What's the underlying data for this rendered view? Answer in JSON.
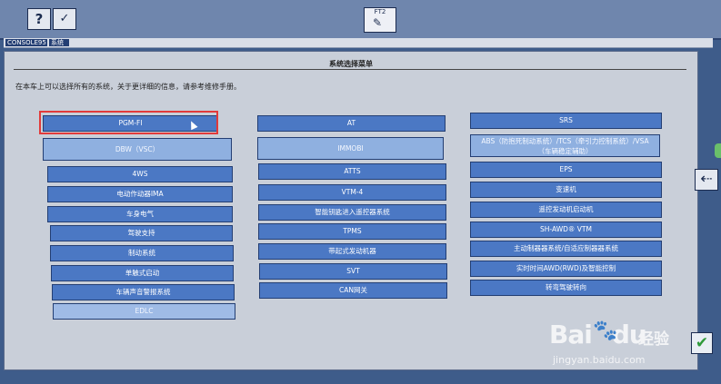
{
  "toolbar": {
    "help_label": "?",
    "check_label": "✓",
    "center_label": "FT2"
  },
  "breadcrumb": [
    "CONSOLE95",
    "系统"
  ],
  "panel": {
    "title": "系统选择菜单",
    "instruction": "在本车上可以选择所有的系统，关于更详细的信息，请参考维修手册。"
  },
  "columns": [
    [
      "PGM-FI",
      "DBW（VSC）",
      "4WS",
      "电动作动器IMA",
      "车身电气",
      "驾驶支持",
      "制动系统",
      "单触式启动",
      "车辆声音警报系统",
      "EDLC"
    ],
    [
      "AT",
      "IMMOBI",
      "ATTS",
      "VTM-4",
      "智能钥匙进入遥控器系统",
      "TPMS",
      "带起式发动机器",
      "SVT",
      "CAN网关"
    ],
    [
      "SRS",
      "ABS（防抱死制动系统）/TCS（牵引力控制系统）/VSA（车辆稳定辅助）",
      "EPS",
      "变速机",
      "遥控发动机启动机",
      "SH-AWD® VTM",
      "主动制器器系统/自适应制器器系统",
      "实时时间AWD(RWD)及智能控制",
      "转弯驾驶转向"
    ]
  ],
  "watermark": {
    "logo_text": "Bai",
    "logo_text2": "du",
    "cn_text": "经验",
    "url": "jingyan.baidu.com"
  },
  "icons": {
    "side": "arrow-left-icon",
    "ok": "checkmark-icon",
    "center": "scan-tool-icon"
  }
}
